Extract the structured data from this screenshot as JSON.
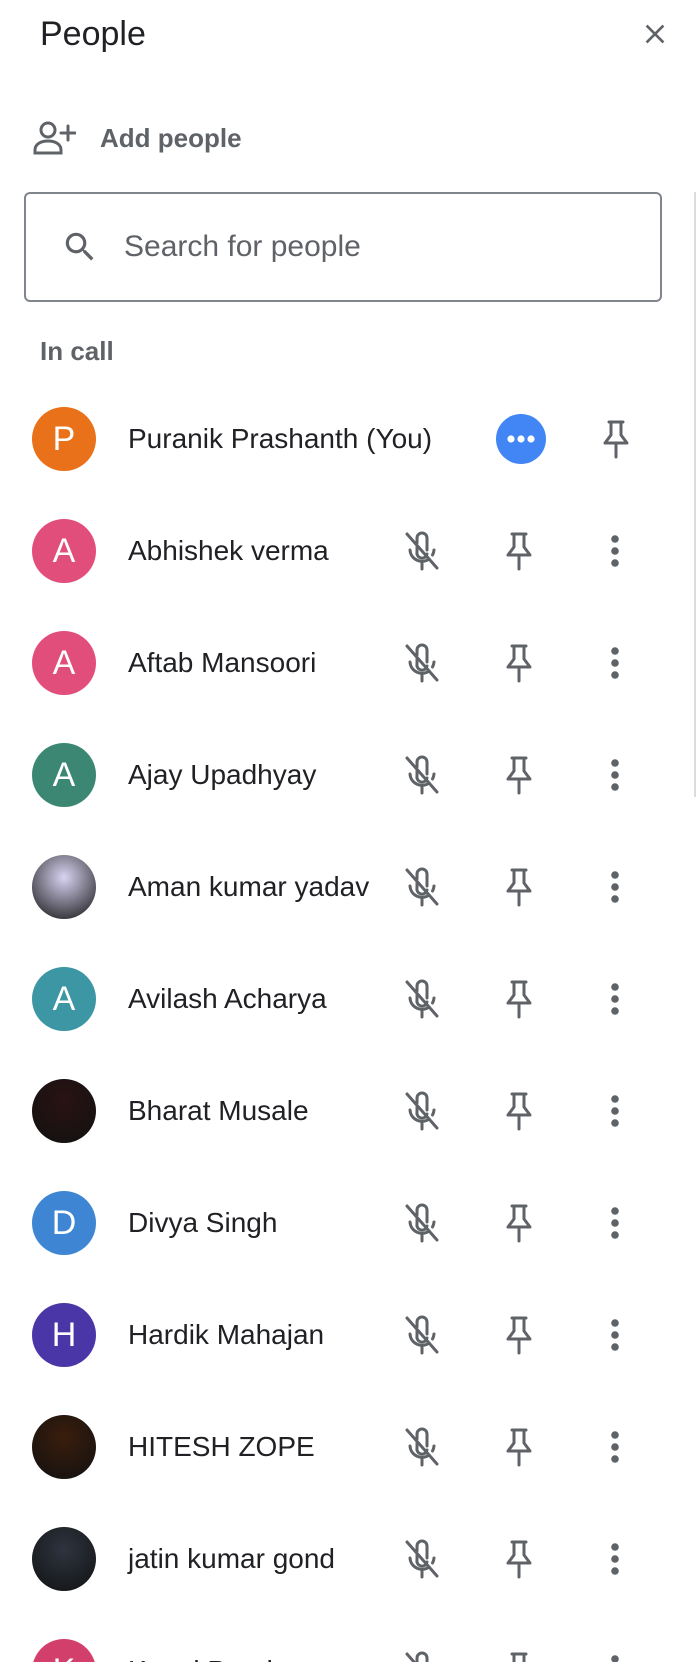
{
  "header": {
    "title": "People",
    "close_icon": "close-icon"
  },
  "add_people": {
    "label": "Add people",
    "icon": "person-add-icon"
  },
  "search": {
    "placeholder": "Search for people",
    "value": "",
    "icon": "search-icon"
  },
  "section": {
    "label": "In call"
  },
  "colors": {
    "accent_blue": "#4285f4",
    "icon_grey": "#5f6368",
    "text_dark": "#202124"
  },
  "self": {
    "name": "Puranik Prashanth (You)",
    "initial": "P",
    "avatar_color": "#e8711a"
  },
  "participants": [
    {
      "name": "Abhishek verma",
      "initial": "A",
      "avatar_color": "#e24e7b",
      "photo": false
    },
    {
      "name": "Aftab Mansoori",
      "initial": "A",
      "avatar_color": "#e24e7b",
      "photo": false
    },
    {
      "name": "Ajay Upadhyay",
      "initial": "A",
      "avatar_color": "#3b8773",
      "photo": false
    },
    {
      "name": "Aman kumar yadav",
      "initial": "",
      "avatar_color": "#d9d4f2",
      "photo": true
    },
    {
      "name": "Avilash Acharya",
      "initial": "A",
      "avatar_color": "#3d96a3",
      "photo": false
    },
    {
      "name": "Bharat Musale",
      "initial": "",
      "avatar_color": "#2a1212",
      "photo": true
    },
    {
      "name": "Divya Singh",
      "initial": "D",
      "avatar_color": "#3e86d4",
      "photo": false
    },
    {
      "name": "Hardik Mahajan",
      "initial": "H",
      "avatar_color": "#4b36a8",
      "photo": false
    },
    {
      "name": "HITESH ZOPE",
      "initial": "",
      "avatar_color": "#3a1d0c",
      "photo": true
    },
    {
      "name": "jatin kumar gond",
      "initial": "",
      "avatar_color": "#2e3540",
      "photo": true
    },
    {
      "name": "Kunal Pandey",
      "initial": "K",
      "avatar_color": "#d23f6b",
      "photo": false
    }
  ]
}
